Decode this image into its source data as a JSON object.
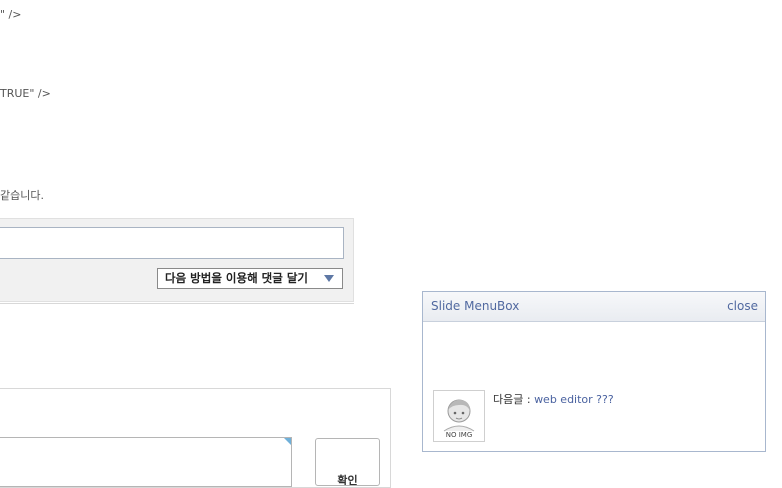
{
  "fragments": {
    "line1": "\" />",
    "line2": "TRUE\" />",
    "line3": "같습니다."
  },
  "comment": {
    "method_label": "다음 방법을 이용해 댓글 달기"
  },
  "write": {
    "confirm_label": "확인"
  },
  "slide_menu": {
    "title": "Slide MenuBox",
    "close_label": "close",
    "thumbnail_caption": "NO IMG",
    "next_prefix": "다음글 : ",
    "next_link": "web editor ???"
  },
  "colors": {
    "accent": "#5169a0",
    "border": "#a8b7ce",
    "select_arrow": "#5e78a5"
  }
}
